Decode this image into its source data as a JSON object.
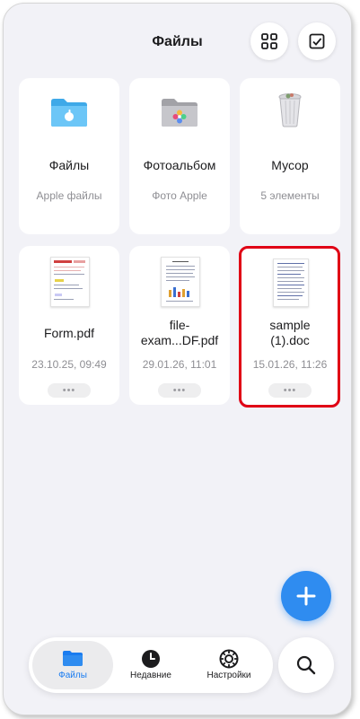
{
  "header": {
    "title": "Файлы"
  },
  "folders": [
    {
      "name": "Файлы",
      "subtitle": "Apple файлы",
      "icon": "blue-folder-icon"
    },
    {
      "name": "Фотоальбом",
      "subtitle": "Фото Apple",
      "icon": "photos-folder-icon"
    },
    {
      "name": "Мусор",
      "subtitle": "5 элементы",
      "icon": "trash-bin-icon"
    }
  ],
  "files": [
    {
      "name_line1": "Form.pdf",
      "name_line2": "",
      "date": "23.10.25, 09:49",
      "more": "•••"
    },
    {
      "name_line1": "file-",
      "name_line2": "exam...DF.pdf",
      "date": "29.01.26, 11:01",
      "more": "•••"
    },
    {
      "name_line1": "sample",
      "name_line2": "(1).doc",
      "date": "15.01.26, 11:26",
      "more": "•••"
    }
  ],
  "tabs": [
    {
      "label": "Файлы",
      "icon": "folder-icon",
      "active": true
    },
    {
      "label": "Недавние",
      "icon": "clock-icon",
      "active": false
    },
    {
      "label": "Настройки",
      "icon": "gear-icon",
      "active": false
    }
  ],
  "colors": {
    "accent": "#2f8cf0",
    "highlight": "#e00015",
    "background": "#f2f2f7"
  }
}
